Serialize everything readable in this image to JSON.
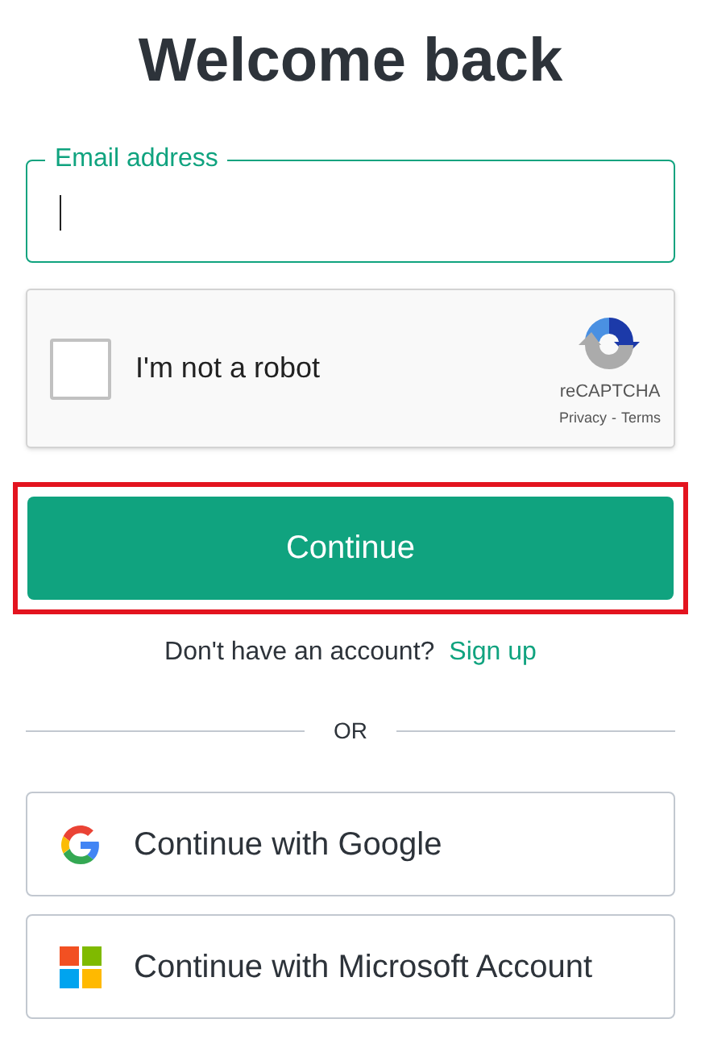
{
  "title": "Welcome back",
  "email_field": {
    "label": "Email address",
    "focused": true
  },
  "captcha": {
    "label": "I'm not a robot",
    "checked": false,
    "brand": "reCAPTCHA",
    "privacy_link": "Privacy",
    "separator": "-",
    "terms_link": "Terms"
  },
  "continue_button": {
    "label": "Continue",
    "highlighted": true
  },
  "signup_prompt": {
    "text": "Don't have an account?",
    "link": "Sign up"
  },
  "divider_label": "OR",
  "social_buttons": [
    {
      "kind": "google",
      "label": "Continue with Google"
    },
    {
      "kind": "microsoft",
      "label": "Continue with Microsoft Account"
    }
  ]
}
